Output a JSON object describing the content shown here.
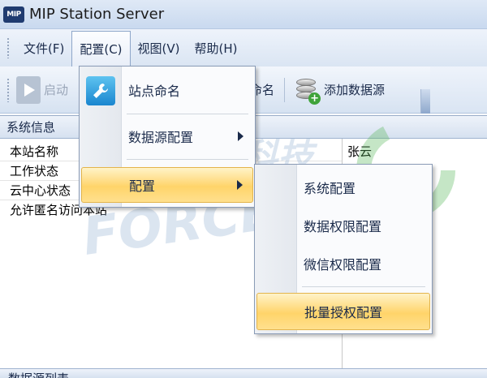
{
  "window": {
    "title": "MIP Station Server",
    "app_icon_text": "MIP"
  },
  "menubar": {
    "items": [
      {
        "label": "文件(F)"
      },
      {
        "label": "配置(C)"
      },
      {
        "label": "视图(V)"
      },
      {
        "label": "帮助(H)"
      }
    ]
  },
  "toolbar": {
    "start_label": "启动",
    "rename_label_partial": "命名",
    "add_datasource_label": "添加数据源"
  },
  "panel": {
    "header": "系统信息",
    "rows": [
      {
        "key": "本站名称",
        "value": "张云"
      },
      {
        "key": "工作状态",
        "value": ""
      },
      {
        "key": "云中心状态",
        "value": ""
      },
      {
        "key": "允许匿名访问本站",
        "value": ""
      }
    ]
  },
  "bottom_strip": {
    "label": "数据源列表"
  },
  "watermark": {
    "text_cn": "力控科技",
    "text_en": "FORCECON"
  },
  "config_menu": {
    "items": [
      {
        "label": "站点命名"
      },
      {
        "label": "数据源配置"
      },
      {
        "label": "配置"
      }
    ]
  },
  "sub_menu": {
    "items": [
      {
        "label": "系统配置"
      },
      {
        "label": "数据权限配置"
      },
      {
        "label": "微信权限配置"
      },
      {
        "label": "批量授权配置"
      }
    ]
  },
  "colors": {
    "menu_highlight": "#ffd46a",
    "chrome_blue": "#dae5f3",
    "watermark_green": "#5bb85d",
    "watermark_blue": "#9bb6d6"
  }
}
